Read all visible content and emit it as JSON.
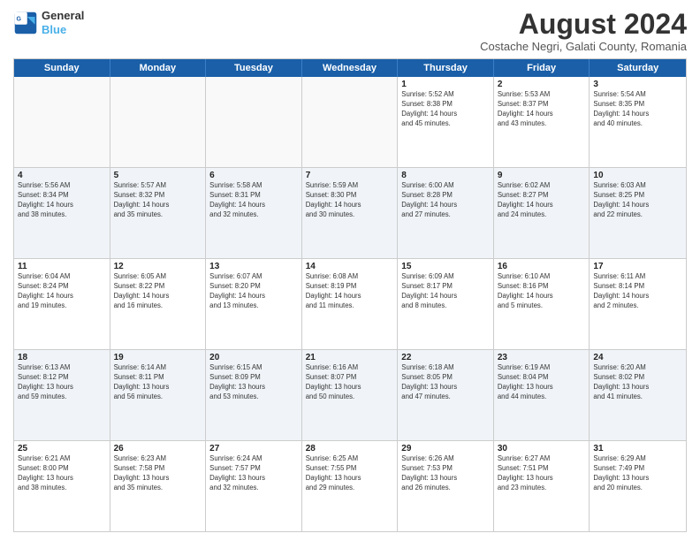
{
  "logo": {
    "line1": "General",
    "line2": "Blue"
  },
  "title": "August 2024",
  "location": "Costache Negri, Galati County, Romania",
  "header": {
    "days": [
      "Sunday",
      "Monday",
      "Tuesday",
      "Wednesday",
      "Thursday",
      "Friday",
      "Saturday"
    ]
  },
  "weeks": [
    {
      "cells": [
        {
          "day": "",
          "detail": ""
        },
        {
          "day": "",
          "detail": ""
        },
        {
          "day": "",
          "detail": ""
        },
        {
          "day": "",
          "detail": ""
        },
        {
          "day": "1",
          "detail": "Sunrise: 5:52 AM\nSunset: 8:38 PM\nDaylight: 14 hours\nand 45 minutes."
        },
        {
          "day": "2",
          "detail": "Sunrise: 5:53 AM\nSunset: 8:37 PM\nDaylight: 14 hours\nand 43 minutes."
        },
        {
          "day": "3",
          "detail": "Sunrise: 5:54 AM\nSunset: 8:35 PM\nDaylight: 14 hours\nand 40 minutes."
        }
      ]
    },
    {
      "cells": [
        {
          "day": "4",
          "detail": "Sunrise: 5:56 AM\nSunset: 8:34 PM\nDaylight: 14 hours\nand 38 minutes."
        },
        {
          "day": "5",
          "detail": "Sunrise: 5:57 AM\nSunset: 8:32 PM\nDaylight: 14 hours\nand 35 minutes."
        },
        {
          "day": "6",
          "detail": "Sunrise: 5:58 AM\nSunset: 8:31 PM\nDaylight: 14 hours\nand 32 minutes."
        },
        {
          "day": "7",
          "detail": "Sunrise: 5:59 AM\nSunset: 8:30 PM\nDaylight: 14 hours\nand 30 minutes."
        },
        {
          "day": "8",
          "detail": "Sunrise: 6:00 AM\nSunset: 8:28 PM\nDaylight: 14 hours\nand 27 minutes."
        },
        {
          "day": "9",
          "detail": "Sunrise: 6:02 AM\nSunset: 8:27 PM\nDaylight: 14 hours\nand 24 minutes."
        },
        {
          "day": "10",
          "detail": "Sunrise: 6:03 AM\nSunset: 8:25 PM\nDaylight: 14 hours\nand 22 minutes."
        }
      ]
    },
    {
      "cells": [
        {
          "day": "11",
          "detail": "Sunrise: 6:04 AM\nSunset: 8:24 PM\nDaylight: 14 hours\nand 19 minutes."
        },
        {
          "day": "12",
          "detail": "Sunrise: 6:05 AM\nSunset: 8:22 PM\nDaylight: 14 hours\nand 16 minutes."
        },
        {
          "day": "13",
          "detail": "Sunrise: 6:07 AM\nSunset: 8:20 PM\nDaylight: 14 hours\nand 13 minutes."
        },
        {
          "day": "14",
          "detail": "Sunrise: 6:08 AM\nSunset: 8:19 PM\nDaylight: 14 hours\nand 11 minutes."
        },
        {
          "day": "15",
          "detail": "Sunrise: 6:09 AM\nSunset: 8:17 PM\nDaylight: 14 hours\nand 8 minutes."
        },
        {
          "day": "16",
          "detail": "Sunrise: 6:10 AM\nSunset: 8:16 PM\nDaylight: 14 hours\nand 5 minutes."
        },
        {
          "day": "17",
          "detail": "Sunrise: 6:11 AM\nSunset: 8:14 PM\nDaylight: 14 hours\nand 2 minutes."
        }
      ]
    },
    {
      "cells": [
        {
          "day": "18",
          "detail": "Sunrise: 6:13 AM\nSunset: 8:12 PM\nDaylight: 13 hours\nand 59 minutes."
        },
        {
          "day": "19",
          "detail": "Sunrise: 6:14 AM\nSunset: 8:11 PM\nDaylight: 13 hours\nand 56 minutes."
        },
        {
          "day": "20",
          "detail": "Sunrise: 6:15 AM\nSunset: 8:09 PM\nDaylight: 13 hours\nand 53 minutes."
        },
        {
          "day": "21",
          "detail": "Sunrise: 6:16 AM\nSunset: 8:07 PM\nDaylight: 13 hours\nand 50 minutes."
        },
        {
          "day": "22",
          "detail": "Sunrise: 6:18 AM\nSunset: 8:05 PM\nDaylight: 13 hours\nand 47 minutes."
        },
        {
          "day": "23",
          "detail": "Sunrise: 6:19 AM\nSunset: 8:04 PM\nDaylight: 13 hours\nand 44 minutes."
        },
        {
          "day": "24",
          "detail": "Sunrise: 6:20 AM\nSunset: 8:02 PM\nDaylight: 13 hours\nand 41 minutes."
        }
      ]
    },
    {
      "cells": [
        {
          "day": "25",
          "detail": "Sunrise: 6:21 AM\nSunset: 8:00 PM\nDaylight: 13 hours\nand 38 minutes."
        },
        {
          "day": "26",
          "detail": "Sunrise: 6:23 AM\nSunset: 7:58 PM\nDaylight: 13 hours\nand 35 minutes."
        },
        {
          "day": "27",
          "detail": "Sunrise: 6:24 AM\nSunset: 7:57 PM\nDaylight: 13 hours\nand 32 minutes."
        },
        {
          "day": "28",
          "detail": "Sunrise: 6:25 AM\nSunset: 7:55 PM\nDaylight: 13 hours\nand 29 minutes."
        },
        {
          "day": "29",
          "detail": "Sunrise: 6:26 AM\nSunset: 7:53 PM\nDaylight: 13 hours\nand 26 minutes."
        },
        {
          "day": "30",
          "detail": "Sunrise: 6:27 AM\nSunset: 7:51 PM\nDaylight: 13 hours\nand 23 minutes."
        },
        {
          "day": "31",
          "detail": "Sunrise: 6:29 AM\nSunset: 7:49 PM\nDaylight: 13 hours\nand 20 minutes."
        }
      ]
    }
  ]
}
